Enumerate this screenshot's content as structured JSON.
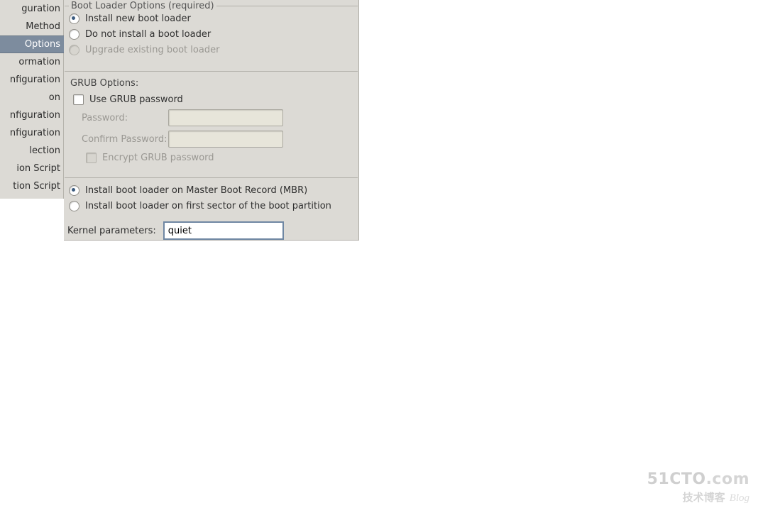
{
  "sidebar": {
    "items": [
      {
        "label": "guration"
      },
      {
        "label": "Method"
      },
      {
        "label": "Options",
        "selected": true
      },
      {
        "label": "ormation"
      },
      {
        "label": "nfiguration"
      },
      {
        "label": "on"
      },
      {
        "label": "nfiguration"
      },
      {
        "label": "nfiguration"
      },
      {
        "label": "lection"
      },
      {
        "label": "ion Script"
      },
      {
        "label": "tion Script"
      }
    ]
  },
  "group_title": "Boot Loader Options (required)",
  "install_options": {
    "install_new": {
      "label": "Install new boot loader",
      "checked": true,
      "enabled": true
    },
    "do_not_install": {
      "label": "Do not install a boot loader",
      "checked": false,
      "enabled": true
    },
    "upgrade": {
      "label": "Upgrade existing boot loader",
      "checked": false,
      "enabled": false
    }
  },
  "grub": {
    "section_label": "GRUB Options:",
    "use_password": {
      "label": "Use GRUB password",
      "checked": false
    },
    "password_label": "Password:",
    "confirm_label": "Confirm Password:",
    "password_value": "",
    "confirm_value": "",
    "encrypt": {
      "label": "Encrypt GRUB password",
      "checked": false,
      "enabled": false
    }
  },
  "location": {
    "mbr": {
      "label": "Install boot loader on Master Boot Record (MBR)",
      "checked": true
    },
    "first": {
      "label": "Install boot loader on first sector of the boot partition",
      "checked": false
    }
  },
  "kernel": {
    "label": "Kernel parameters:",
    "value": "quiet"
  },
  "watermark": {
    "line1a": "51CTO",
    "line1b": ".com",
    "line2a": "技术博客",
    "line2b": "Blog"
  }
}
